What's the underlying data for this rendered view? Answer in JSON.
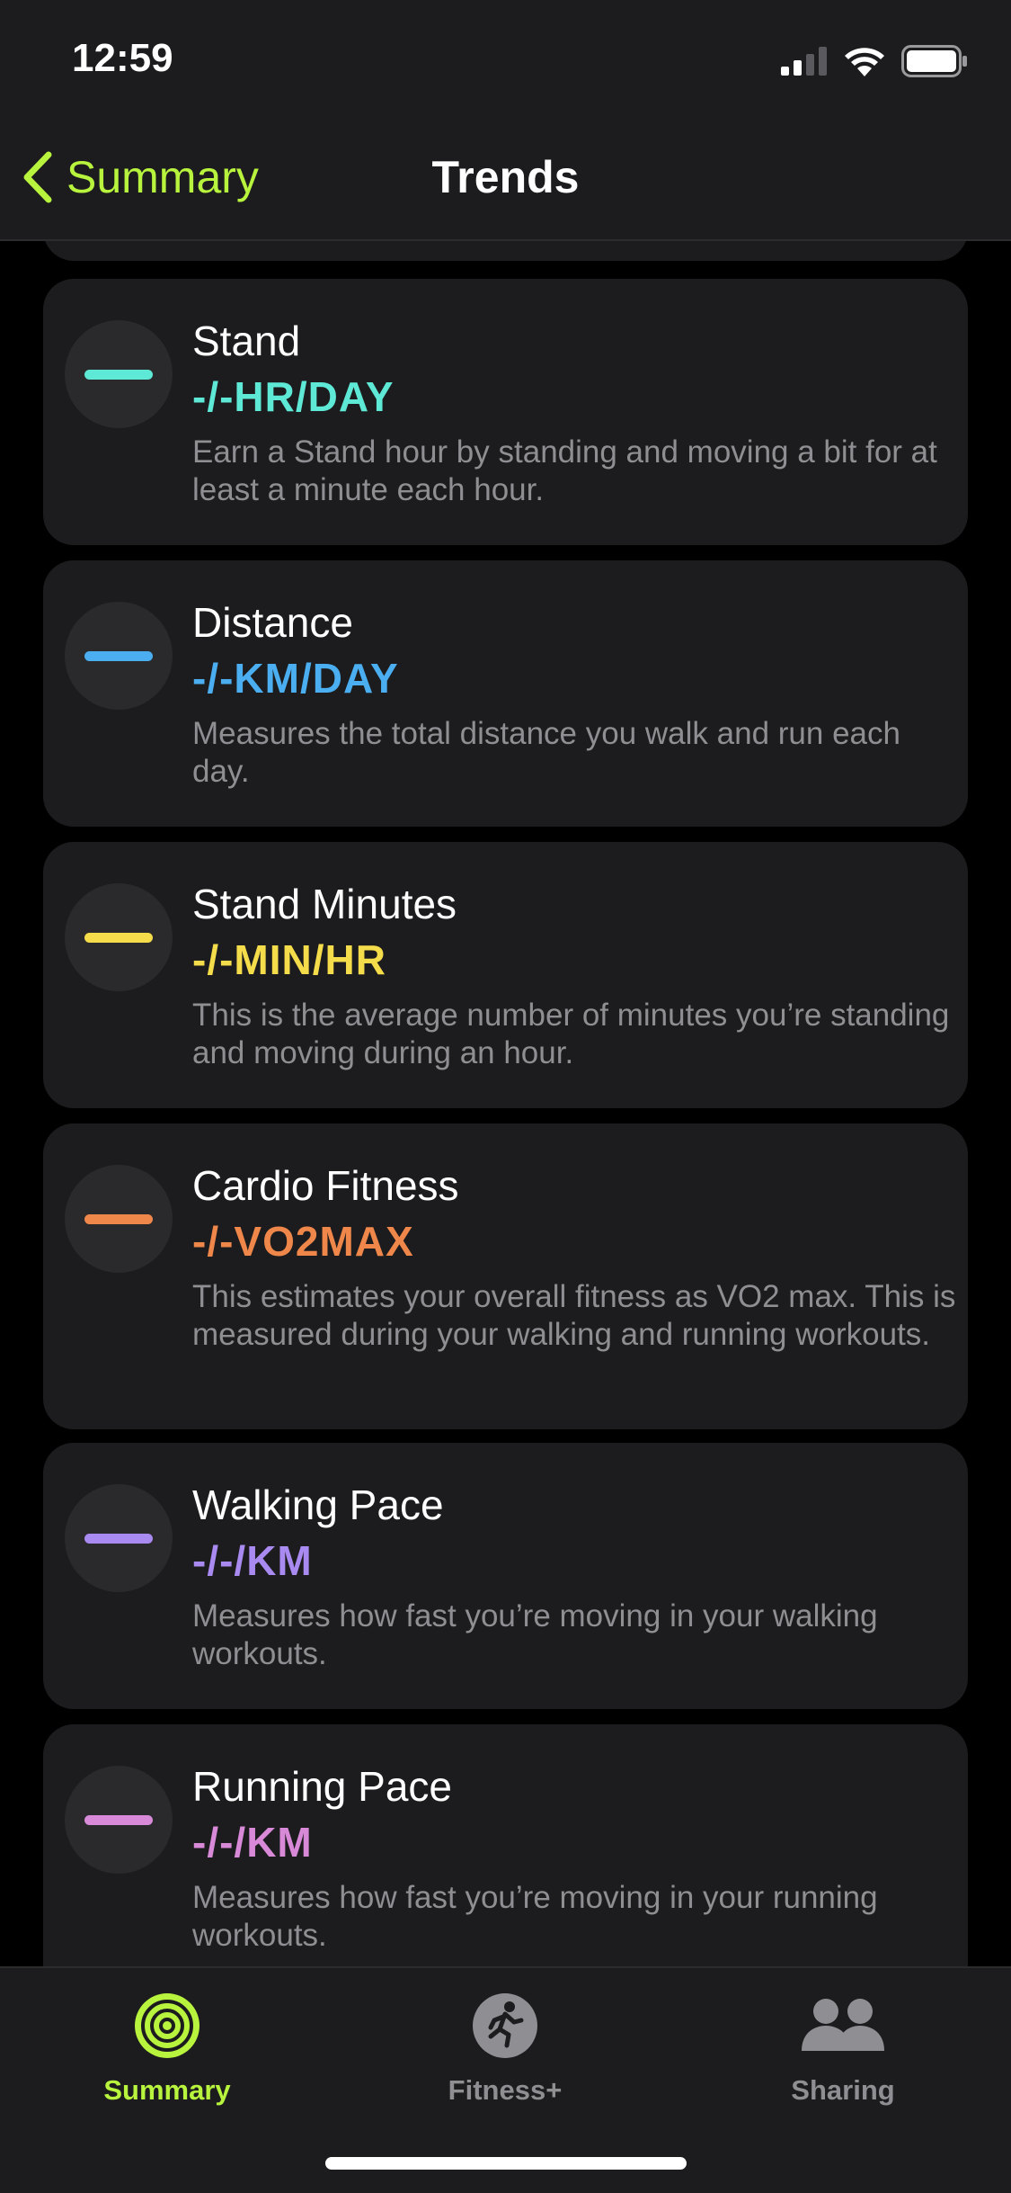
{
  "status_bar": {
    "time": "12:59"
  },
  "nav": {
    "back_label": "Summary",
    "title": "Trends"
  },
  "cards": [
    {
      "title": "Stand",
      "value": "-/-HR/DAY",
      "description": "Earn a Stand hour by standing and moving a bit for at least a minute each hour.",
      "color": "#5ee8d6"
    },
    {
      "title": "Distance",
      "value": "-/-KM/DAY",
      "description": "Measures the total distance you walk and run each day.",
      "color": "#4aaef0"
    },
    {
      "title": "Stand Minutes",
      "value": "-/-MIN/HR",
      "description": "This is the average number of minutes you’re standing and moving during an hour.",
      "color": "#f5dc4a"
    },
    {
      "title": "Cardio Fitness",
      "value": "-/-VO2MAX",
      "description": "This estimates your overall fitness as VO2 max. This is measured during your walking and running workouts.",
      "color": "#f0874a"
    },
    {
      "title": "Walking Pace",
      "value": "-/-/KM",
      "description": "Measures how fast you’re moving in your walking workouts.",
      "color": "#a98af0"
    },
    {
      "title": "Running Pace",
      "value": "-/-/KM",
      "description": "Measures how fast you’re moving in your running workouts.",
      "color": "#d88ad8"
    }
  ],
  "tabs": [
    {
      "label": "Summary",
      "icon": "activity-rings-icon",
      "active": true
    },
    {
      "label": "Fitness+",
      "icon": "running-figure-icon",
      "active": false
    },
    {
      "label": "Sharing",
      "icon": "people-icon",
      "active": false
    }
  ],
  "colors": {
    "accent": "#b8f33d",
    "inactive": "#8e8e93",
    "background": "#000000",
    "card": "#1c1c1e"
  }
}
